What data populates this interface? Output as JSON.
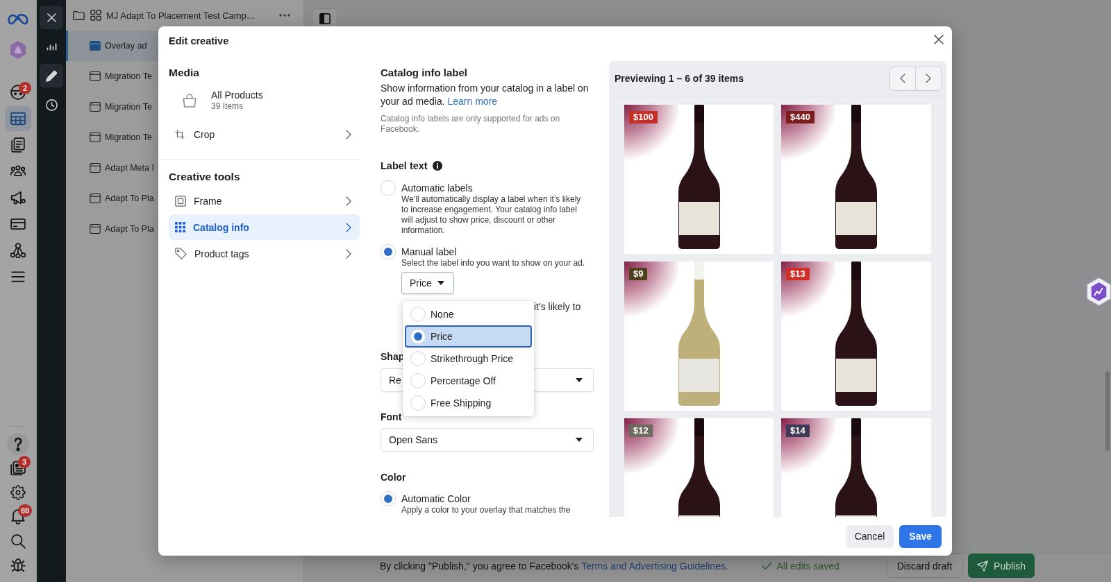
{
  "nav_rail": {
    "top": [
      {
        "selected": false,
        "badge": "2"
      },
      {
        "selected": true
      },
      {
        "selected": false
      },
      {
        "selected": false
      },
      {
        "selected": false
      },
      {
        "selected": false
      },
      {
        "selected": false
      },
      {
        "selected": false
      }
    ],
    "bottom": [
      {
        "selected": false
      },
      {
        "selected": false,
        "badge": "3"
      },
      {
        "selected": false
      },
      {
        "selected": false,
        "badge": "88"
      },
      {
        "selected": false
      },
      {
        "selected": false
      }
    ]
  },
  "tool_bar": {
    "items": [
      {
        "selected": false
      },
      {
        "selected": true
      },
      {
        "selected": false
      }
    ]
  },
  "campaign": {
    "label": "MJ Adapt To Placement Test Camp…",
    "children": [
      {
        "label": "Overlay ad",
        "selected": true
      },
      {
        "label": "Migration Te",
        "selected": false
      },
      {
        "label": "Migration Te",
        "selected": false
      },
      {
        "label": "Migration Te",
        "selected": false
      },
      {
        "label": "Adapt Meta I",
        "selected": false
      },
      {
        "label": "Adapt To Pla",
        "selected": false
      },
      {
        "label": "Adapt To Pla",
        "selected": false
      }
    ]
  },
  "dialog": {
    "title": "Edit creative",
    "media": {
      "heading": "Media",
      "catalog_name": "All Products",
      "catalog_count": "39 Items",
      "crop": "Crop"
    },
    "creative_tools": {
      "heading": "Creative tools",
      "items": [
        {
          "label": "Frame",
          "selected": false
        },
        {
          "label": "Catalog info",
          "selected": true
        },
        {
          "label": "Product tags",
          "selected": false
        }
      ]
    },
    "catalog_info_label": {
      "heading": "Catalog info label",
      "description": "Show information from your catalog in a label on your ad media.",
      "link": "Learn more",
      "note": "Catalog info labels are only supported for ads on Facebook."
    },
    "label_text": {
      "heading": "Label text",
      "options": [
        {
          "title": "Automatic labels",
          "description": "We’ll automatically display a label when it’s likely to increase engagement. Your catalog info label will adjust to show price, discount or other information.",
          "selected": false
        },
        {
          "title": "Manual label",
          "description": "Select the label info you want to show on your ad.",
          "selected": true
        }
      ],
      "label_info": {
        "value": "Price",
        "expanded": true,
        "options": [
          {
            "label": "None",
            "selected": false
          },
          {
            "label": "Price",
            "selected": true
          },
          {
            "label": "Strikethrough Price",
            "selected": false
          },
          {
            "label": "Percentage Off",
            "selected": false
          },
          {
            "label": "Free Shipping",
            "selected": false
          }
        ]
      },
      "partly_covered_text": "it's likely to"
    },
    "shape": {
      "heading": "Shap",
      "value": "Re"
    },
    "font": {
      "heading": "Font",
      "value": "Open Sans"
    },
    "color": {
      "heading": "Color",
      "options": [
        {
          "title": "Automatic Color",
          "description": "Apply a color to your overlay that matches the",
          "selected": true
        }
      ]
    },
    "preview": {
      "title": "Previewing 1 – 6 of 39 items",
      "items": [
        {
          "price": "$100",
          "color": "#c62f28",
          "kind": "red"
        },
        {
          "price": "$440",
          "color": "#7d1c1c",
          "kind": "red"
        },
        {
          "price": "$9",
          "color": "#51401f",
          "kind": "white"
        },
        {
          "price": "$13",
          "color": "#cf2f27",
          "kind": "red"
        },
        {
          "price": "$12",
          "color": "#6f6a60",
          "kind": "red"
        },
        {
          "price": "$14",
          "color": "#3e3a55",
          "kind": "red"
        }
      ]
    },
    "buttons": {
      "cancel": "Cancel",
      "save": "Save"
    }
  },
  "bottom_bar": {
    "notice": "By clicking \"Publish,\" you agree to Facebook's",
    "link": "Terms and Advertising Guidelines",
    "notice_end": ".",
    "status": "All edits saved",
    "discard": "Discard draft",
    "publish": "Publish"
  }
}
